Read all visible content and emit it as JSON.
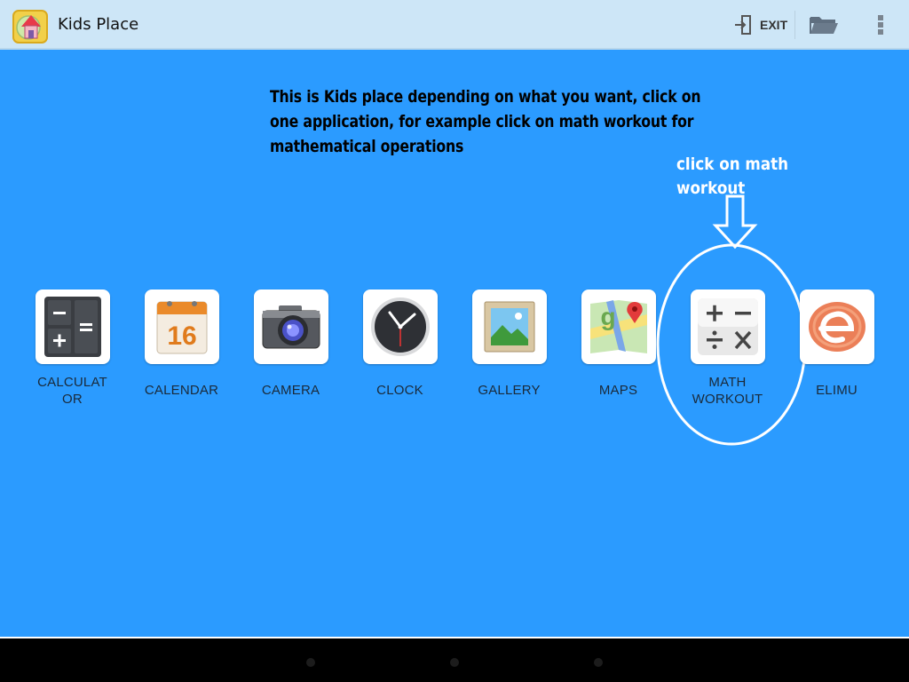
{
  "app": {
    "title": "Kids Place"
  },
  "toolbar": {
    "exit_label": "EXIT"
  },
  "annotation": {
    "instruction_lines": [
      "This is Kids place depending on what you want, click on",
      "one application, for example click on math workout for",
      "mathematical operations"
    ],
    "callout_lines": [
      "click on math",
      "workout"
    ]
  },
  "apps": [
    {
      "label_lines": [
        "CALCULAT",
        "OR"
      ],
      "icon": "calculator-icon"
    },
    {
      "label_lines": [
        "CALENDAR"
      ],
      "icon": "calendar-icon",
      "icon_text": "16"
    },
    {
      "label_lines": [
        "CAMERA"
      ],
      "icon": "camera-icon"
    },
    {
      "label_lines": [
        "CLOCK"
      ],
      "icon": "clock-icon"
    },
    {
      "label_lines": [
        "GALLERY"
      ],
      "icon": "gallery-icon"
    },
    {
      "label_lines": [
        "MAPS"
      ],
      "icon": "maps-icon"
    },
    {
      "label_lines": [
        "MATH",
        "WORKOUT"
      ],
      "icon": "math-workout-icon"
    },
    {
      "label_lines": [
        "ELIMU"
      ],
      "icon": "elimu-icon"
    }
  ],
  "colors": {
    "background": "#2b9bff",
    "actionbar": "#cde6f7",
    "annotation_ellipse": "#ffffff"
  }
}
